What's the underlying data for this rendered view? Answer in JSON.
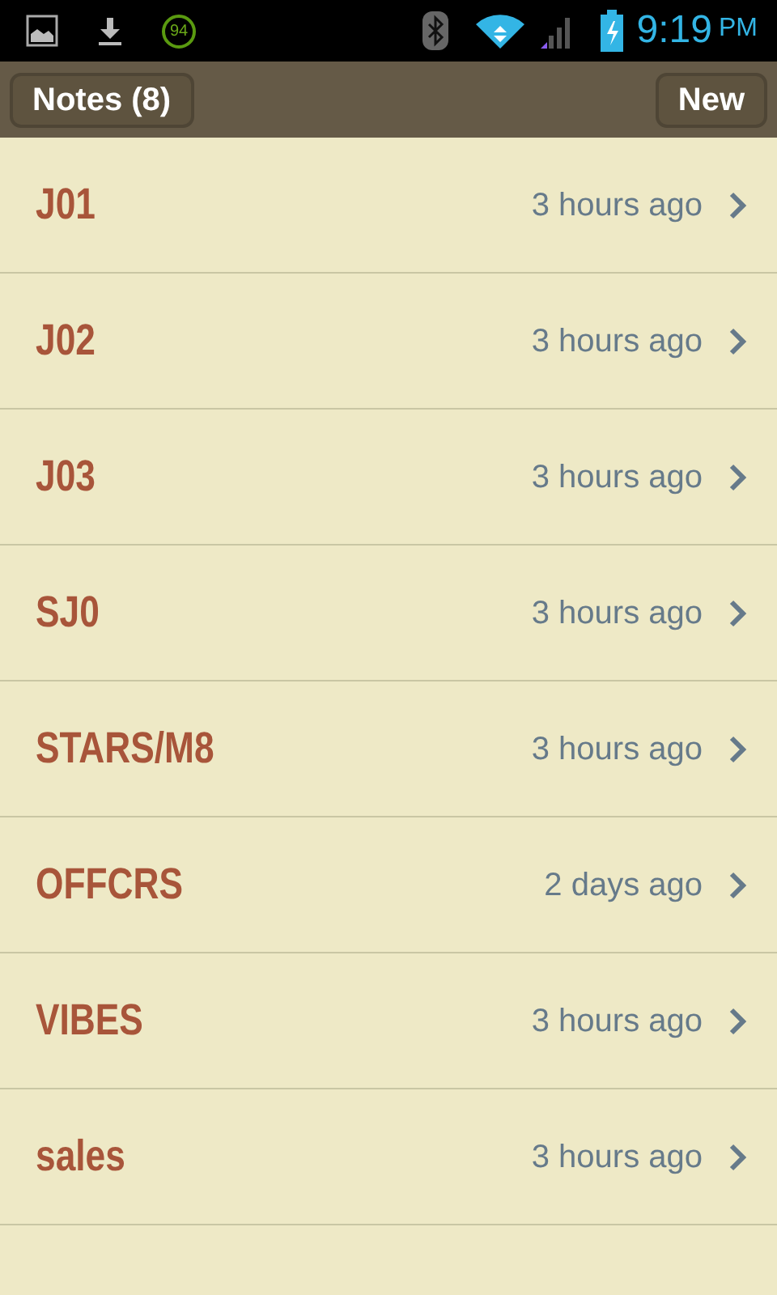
{
  "status_bar": {
    "notification_badge": "94",
    "time": "9:19",
    "meridiem": "PM"
  },
  "header": {
    "title": "Notes (8)",
    "new_button": "New"
  },
  "notes": [
    {
      "title": "J01",
      "time": "3 hours ago"
    },
    {
      "title": "J02",
      "time": "3 hours ago"
    },
    {
      "title": "J03",
      "time": "3 hours ago"
    },
    {
      "title": "SJ0",
      "time": "3 hours ago"
    },
    {
      "title": "STARS/M8",
      "time": "3 hours ago"
    },
    {
      "title": "OFFCRS",
      "time": "2 days ago"
    },
    {
      "title": "VIBES",
      "time": "3 hours ago"
    },
    {
      "title": "sales",
      "time": "3 hours ago"
    }
  ]
}
